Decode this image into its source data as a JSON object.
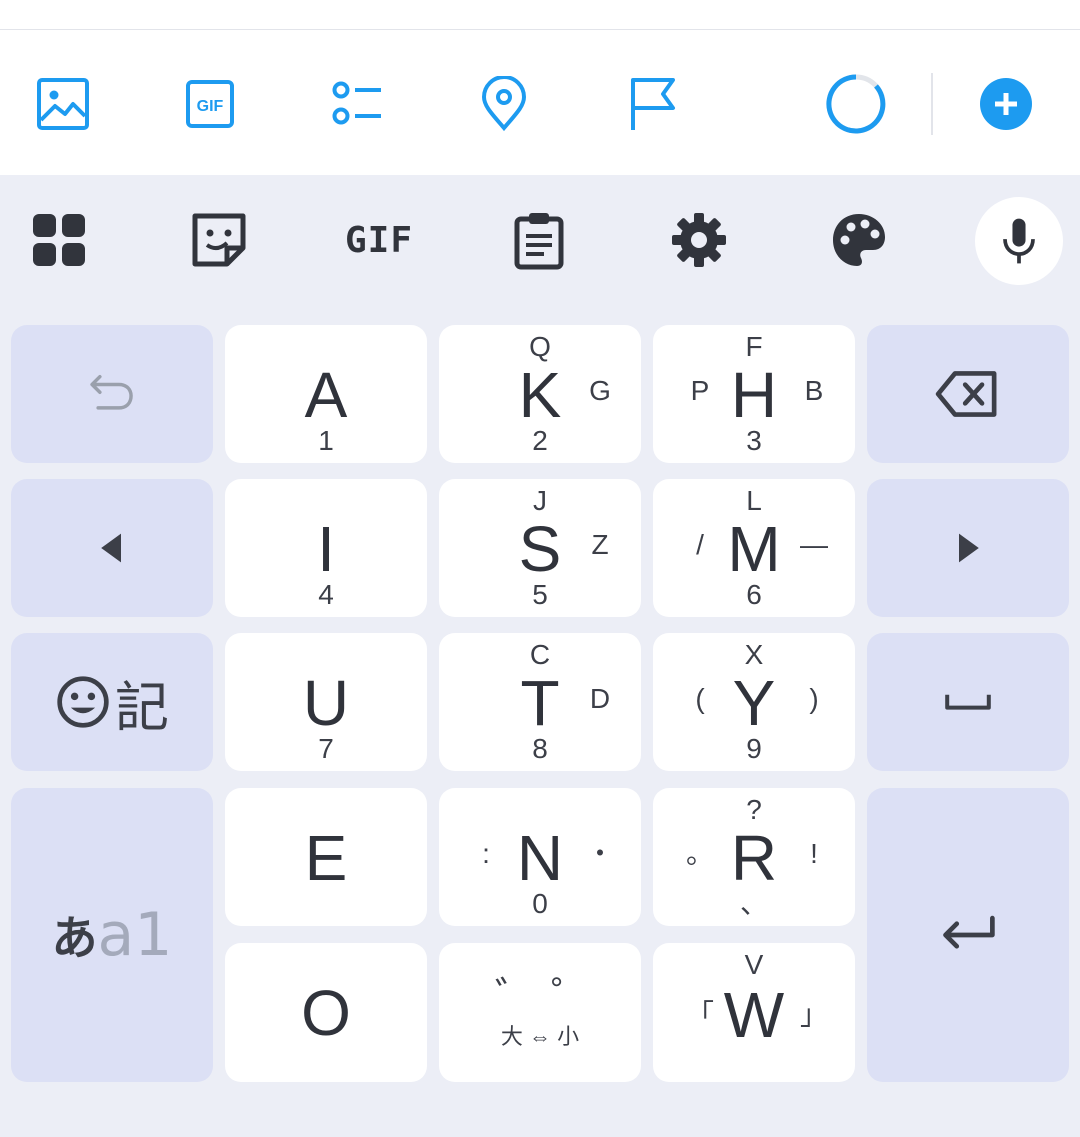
{
  "compose_toolbar": {
    "icons": [
      "image-icon",
      "gif-icon",
      "poll-icon",
      "location-icon",
      "flag-icon",
      "progress-ring-icon",
      "add-icon"
    ],
    "gif_label": "GIF",
    "accent_color": "#1d9bf0"
  },
  "keyboard_toolbar": {
    "icons": [
      "grid-icon",
      "sticker-icon",
      "gif-icon",
      "clipboard-icon",
      "gear-icon",
      "palette-icon",
      "mic-icon"
    ],
    "gif_label": "GIF"
  },
  "keys": {
    "a": {
      "main": "A",
      "bottom": "1"
    },
    "k": {
      "main": "K",
      "top": "Q",
      "right": "G",
      "bottom": "2"
    },
    "h": {
      "main": "H",
      "top": "F",
      "left": "P",
      "right": "B",
      "bottom": "3"
    },
    "i": {
      "main": "I",
      "bottom": "4"
    },
    "s": {
      "main": "S",
      "top": "J",
      "right": "Z",
      "bottom": "5"
    },
    "m": {
      "main": "M",
      "top": "L",
      "left": "/",
      "right": "—",
      "bottom": "6"
    },
    "u": {
      "main": "U",
      "bottom": "7"
    },
    "t": {
      "main": "T",
      "top": "C",
      "right": "D",
      "bottom": "8"
    },
    "y": {
      "main": "Y",
      "top": "X",
      "left": "(",
      "right": ")",
      "bottom": "9"
    },
    "e": {
      "main": "E"
    },
    "n": {
      "main": "N",
      "left": ":",
      "right": "・",
      "bottom": "0"
    },
    "r": {
      "main": "R",
      "top": "?",
      "left": "。",
      "right": "!",
      "bottom": "、"
    },
    "o": {
      "main": "O"
    },
    "dakuten": {
      "left": "゛",
      "right": "゜",
      "bottom": "大 ⇔ 小"
    },
    "w": {
      "main": "W",
      "top": "V",
      "left": "「",
      "right": "」"
    }
  },
  "function_keys": {
    "emoji_symbol": "記",
    "lang_toggle_active": "あ",
    "lang_toggle_inactive": "a1"
  }
}
